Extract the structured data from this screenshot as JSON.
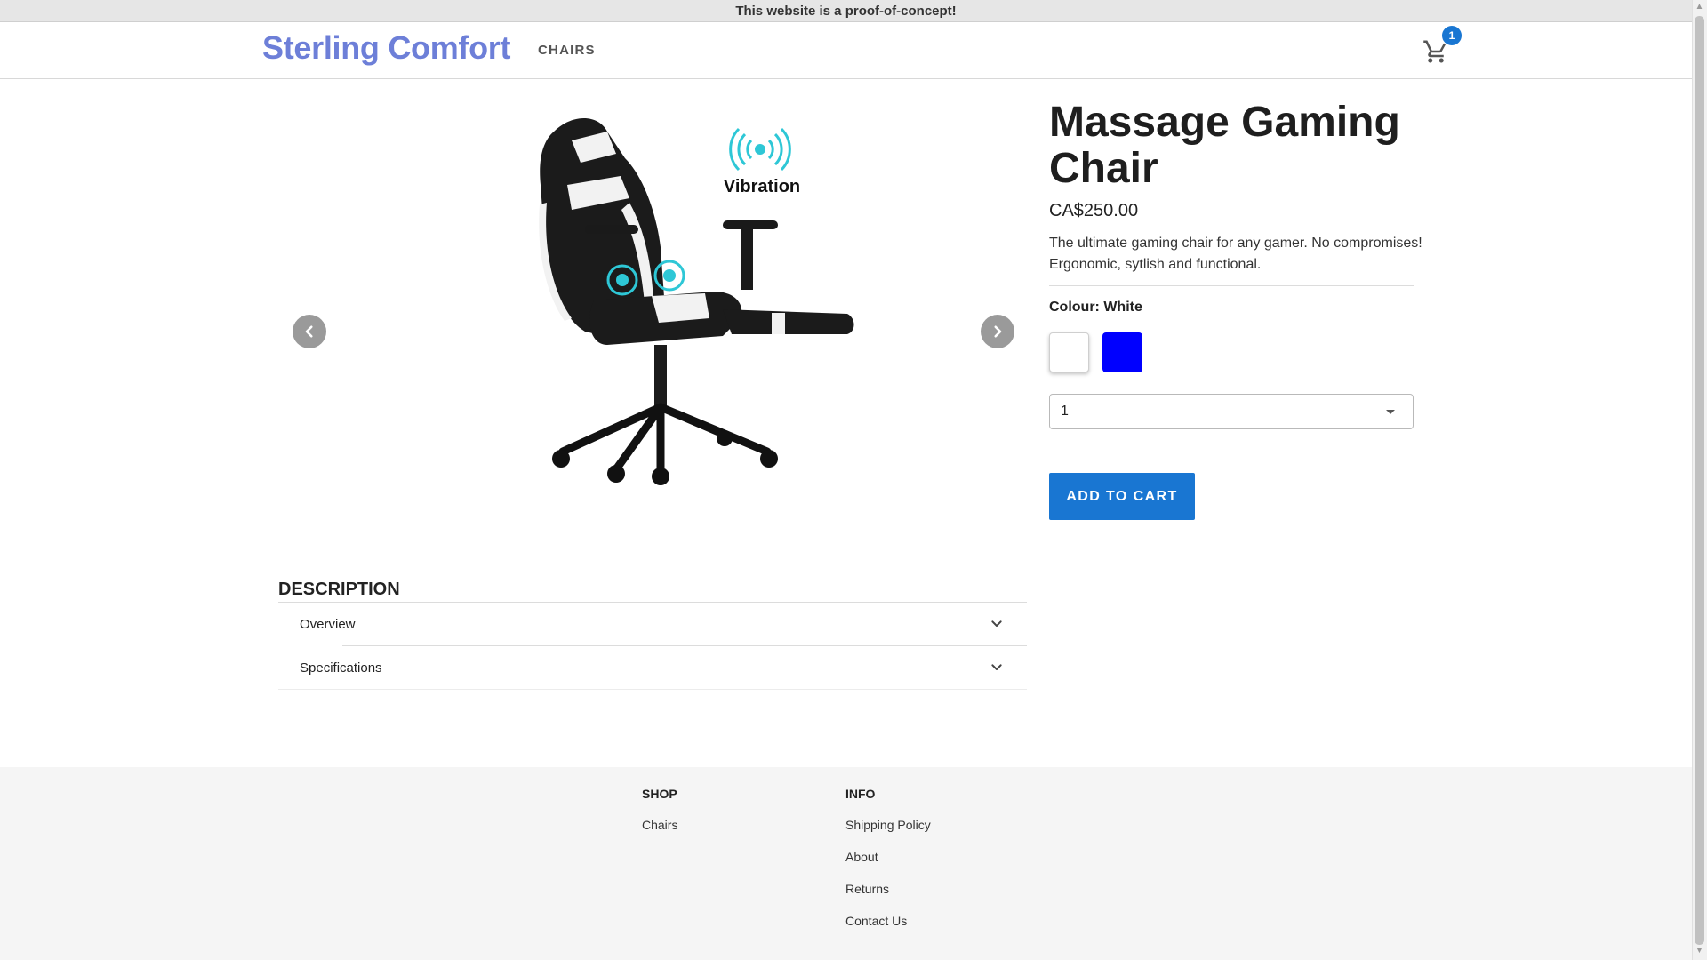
{
  "banner": {
    "text": "This website is a proof-of-concept!"
  },
  "header": {
    "logo": "Sterling Comfort",
    "nav": {
      "chairs": "CHAIRS"
    },
    "cart": {
      "count": "1",
      "icon": "cart-icon"
    }
  },
  "gallery": {
    "badge_text": "Vibration",
    "prev_icon": "chevron-left-icon",
    "next_icon": "chevron-right-icon"
  },
  "description": {
    "title": "DESCRIPTION",
    "sections": [
      {
        "label": "Overview"
      },
      {
        "label": "Specifications"
      }
    ]
  },
  "product": {
    "title": "Massage Gaming Chair",
    "price": "CA$250.00",
    "blurb": "The ultimate gaming chair for any gamer. No compromises! Ergonomic, sytlish and functional.",
    "colour_label": "Colour: White",
    "swatches": [
      {
        "name": "White",
        "hex": "#ffffff"
      },
      {
        "name": "Blue",
        "hex": "#0000ff"
      }
    ],
    "quantity": "1",
    "add_to_cart": "ADD TO CART",
    "accent_color": "#1976d2"
  },
  "footer": {
    "shop": {
      "heading": "SHOP",
      "links": [
        "Chairs"
      ]
    },
    "info": {
      "heading": "INFO",
      "links": [
        "Shipping Policy",
        "About",
        "Returns",
        "Contact Us"
      ]
    }
  }
}
